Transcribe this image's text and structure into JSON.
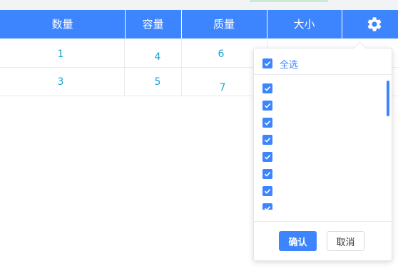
{
  "table": {
    "columns": [
      "数量",
      "容量",
      "质量",
      "大小"
    ],
    "rows": [
      [
        "1",
        "4",
        "6",
        ""
      ],
      [
        "3",
        "5",
        "7",
        ""
      ]
    ],
    "settings_icon": "gear-icon"
  },
  "column_filter": {
    "select_all_label": "全选",
    "select_all_checked": true,
    "items": [
      {
        "label": "",
        "checked": true
      },
      {
        "label": "",
        "checked": true
      },
      {
        "label": "",
        "checked": true
      },
      {
        "label": "",
        "checked": true
      },
      {
        "label": "",
        "checked": true
      },
      {
        "label": "",
        "checked": true
      },
      {
        "label": "",
        "checked": true
      },
      {
        "label": "",
        "checked": true
      }
    ],
    "confirm_label": "确认",
    "cancel_label": "取消"
  },
  "colors": {
    "accent": "#3d85ff",
    "cell_text": "#1aa3d3"
  }
}
